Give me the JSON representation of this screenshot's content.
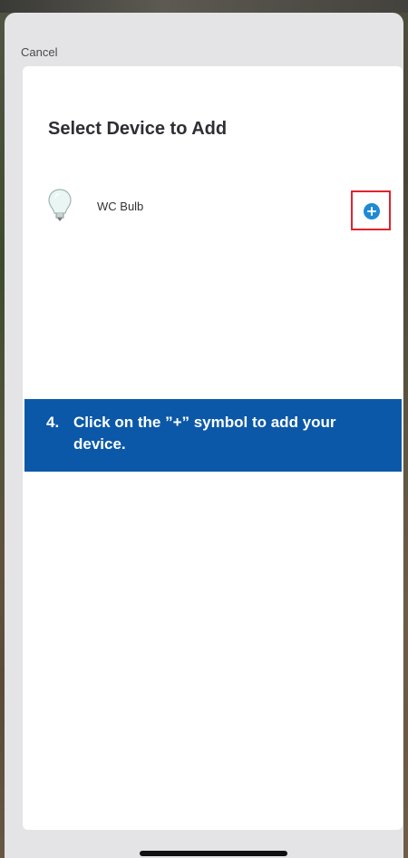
{
  "nav": {
    "cancel_label": "Cancel"
  },
  "page": {
    "title": "Select Device to Add"
  },
  "devices": [
    {
      "label": "WC Bulb",
      "icon": "lightbulb-icon",
      "action_icon": "add-circle-icon"
    }
  ],
  "callout": {
    "step_number": "4.",
    "text": "Click on the ”+” symbol to add your device."
  },
  "colors": {
    "accent_blue": "#1e8ad6",
    "callout_blue": "#0b58a8",
    "highlight_red": "#e0242c"
  }
}
